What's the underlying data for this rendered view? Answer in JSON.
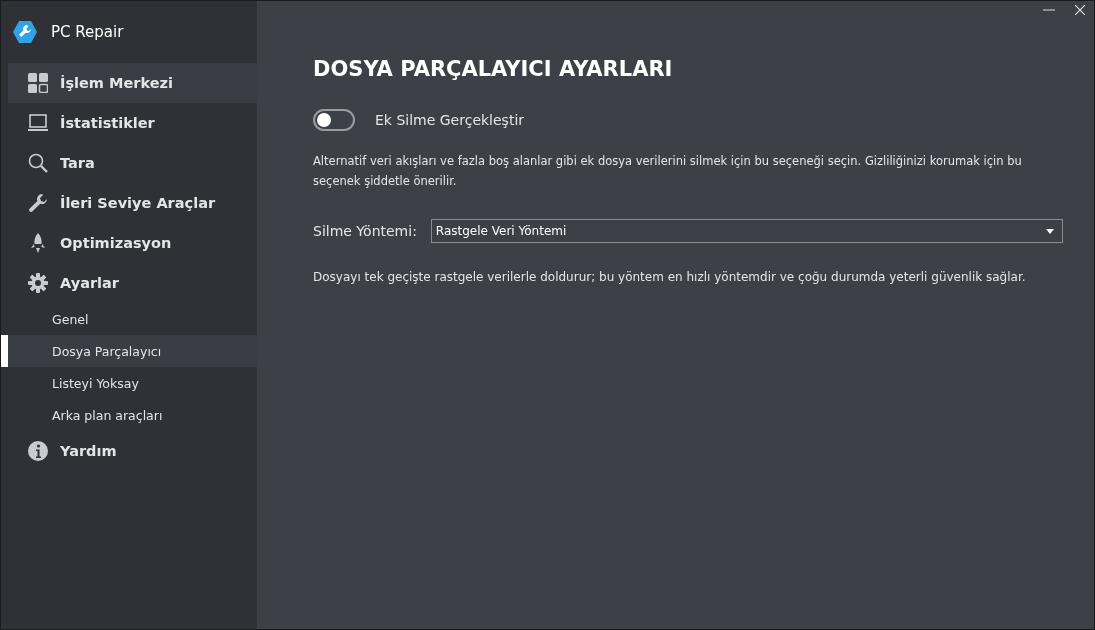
{
  "app": {
    "title": "PC Repair"
  },
  "sidebar": {
    "items": [
      {
        "label": "İşlem Merkezi",
        "selected": true
      },
      {
        "label": "İstatistikler",
        "selected": false
      },
      {
        "label": "Tara",
        "selected": false
      },
      {
        "label": "İleri Seviye Araçlar",
        "selected": false
      },
      {
        "label": "Optimizasyon",
        "selected": false
      },
      {
        "label": "Ayarlar",
        "selected": false,
        "children": [
          {
            "label": "Genel",
            "selected": false
          },
          {
            "label": "Dosya Parçalayıcı",
            "selected": true
          },
          {
            "label": "Listeyi Yoksay",
            "selected": false
          },
          {
            "label": "Arka plan araçları",
            "selected": false
          }
        ]
      },
      {
        "label": "Yardım",
        "selected": false
      }
    ]
  },
  "page": {
    "heading": "DOSYA PARÇALAYICI AYARLARI",
    "toggle": {
      "label": "Ek Silme Gerçekleştir",
      "on": false
    },
    "toggle_description": "Alternatif veri akışları ve fazla boş alanlar gibi ek dosya verilerini silmek için bu seçeneği seçin. Gizliliğinizi korumak için bu seçenek şiddetle önerilir.",
    "method": {
      "label": "Silme Yöntemi:",
      "value": "Rastgele Veri Yöntemi"
    },
    "method_description": "Dosyayı tek geçişte rastgele verilerle doldurur; bu yöntem en hızlı yöntemdir ve çoğu durumda yeterli güvenlik sağlar."
  }
}
